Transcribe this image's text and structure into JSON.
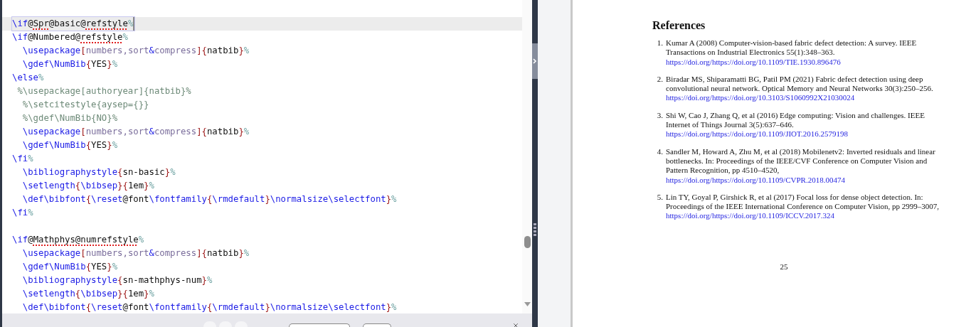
{
  "editor": {
    "lines": [
      {
        "current": true,
        "tokens": [
          {
            "kind": "cmd",
            "text": "\\if"
          },
          {
            "kind": "arg",
            "text": "@"
          },
          {
            "kind": "misspelled",
            "text": "Spr"
          },
          {
            "kind": "arg",
            "text": "@basic@"
          },
          {
            "kind": "misspelled",
            "text": "refstyle"
          },
          {
            "kind": "pct",
            "text": "%"
          }
        ]
      },
      {
        "current": false,
        "tokens": [
          {
            "kind": "cmd",
            "text": "\\if"
          },
          {
            "kind": "arg",
            "text": "@Numbered@"
          },
          {
            "kind": "misspelled",
            "text": "refstyle"
          },
          {
            "kind": "pct",
            "text": "%"
          }
        ]
      },
      {
        "current": false,
        "tokens": [
          {
            "kind": "cmd",
            "text": "  \\usepackage"
          },
          {
            "kind": "brace",
            "text": "["
          },
          {
            "kind": "opt",
            "text": "numbers,sort"
          },
          {
            "kind": "cmd",
            "text": "&"
          },
          {
            "kind": "opt",
            "text": "compress"
          },
          {
            "kind": "brace",
            "text": "]"
          },
          {
            "kind": "brace",
            "text": "{"
          },
          {
            "kind": "arg",
            "text": "natbib"
          },
          {
            "kind": "brace",
            "text": "}"
          },
          {
            "kind": "pct",
            "text": "%"
          }
        ]
      },
      {
        "current": false,
        "tokens": [
          {
            "kind": "cmd",
            "text": "  \\gdef\\NumBib"
          },
          {
            "kind": "brace",
            "text": "{"
          },
          {
            "kind": "arg",
            "text": "YES"
          },
          {
            "kind": "brace",
            "text": "}"
          },
          {
            "kind": "pct",
            "text": "%"
          }
        ]
      },
      {
        "current": false,
        "tokens": [
          {
            "kind": "cmd",
            "text": "\\else"
          },
          {
            "kind": "pct",
            "text": "%"
          }
        ]
      },
      {
        "current": false,
        "tokens": [
          {
            "kind": "comment",
            "text": " %\\usepackage[authoryear]{natbib}%"
          }
        ]
      },
      {
        "current": false,
        "tokens": [
          {
            "kind": "comment",
            "text": "  %\\setcitestyle{aysep={}}"
          }
        ]
      },
      {
        "current": false,
        "tokens": [
          {
            "kind": "comment",
            "text": "  %\\gdef\\NumBib{NO}%"
          }
        ]
      },
      {
        "current": false,
        "tokens": [
          {
            "kind": "cmd",
            "text": "  \\usepackage"
          },
          {
            "kind": "brace",
            "text": "["
          },
          {
            "kind": "opt",
            "text": "numbers,sort"
          },
          {
            "kind": "cmd",
            "text": "&"
          },
          {
            "kind": "opt",
            "text": "compress"
          },
          {
            "kind": "brace",
            "text": "]"
          },
          {
            "kind": "brace",
            "text": "{"
          },
          {
            "kind": "arg",
            "text": "natbib"
          },
          {
            "kind": "brace",
            "text": "}"
          },
          {
            "kind": "pct",
            "text": "%"
          }
        ]
      },
      {
        "current": false,
        "tokens": [
          {
            "kind": "cmd",
            "text": "  \\gdef\\NumBib"
          },
          {
            "kind": "brace",
            "text": "{"
          },
          {
            "kind": "arg",
            "text": "YES"
          },
          {
            "kind": "brace",
            "text": "}"
          },
          {
            "kind": "pct",
            "text": "%"
          }
        ]
      },
      {
        "current": false,
        "tokens": [
          {
            "kind": "cmd",
            "text": "\\fi"
          },
          {
            "kind": "pct",
            "text": "%"
          }
        ]
      },
      {
        "current": false,
        "tokens": [
          {
            "kind": "cmd",
            "text": "  \\bibliographystyle"
          },
          {
            "kind": "brace",
            "text": "{"
          },
          {
            "kind": "arg",
            "text": "sn-basic"
          },
          {
            "kind": "brace",
            "text": "}"
          },
          {
            "kind": "pct",
            "text": "%"
          }
        ]
      },
      {
        "current": false,
        "tokens": [
          {
            "kind": "cmd",
            "text": "  \\setlength"
          },
          {
            "kind": "brace",
            "text": "{"
          },
          {
            "kind": "cmd",
            "text": "\\bibsep"
          },
          {
            "kind": "brace",
            "text": "}{"
          },
          {
            "kind": "arg",
            "text": "1em"
          },
          {
            "kind": "brace",
            "text": "}"
          },
          {
            "kind": "pct",
            "text": "%"
          }
        ]
      },
      {
        "current": false,
        "tokens": [
          {
            "kind": "cmd",
            "text": "  \\def\\bibfont"
          },
          {
            "kind": "brace",
            "text": "{"
          },
          {
            "kind": "cmd",
            "text": "\\reset"
          },
          {
            "kind": "arg",
            "text": "@font"
          },
          {
            "kind": "cmd",
            "text": "\\fontfamily"
          },
          {
            "kind": "brace",
            "text": "{"
          },
          {
            "kind": "cmd",
            "text": "\\rmdefault"
          },
          {
            "kind": "brace",
            "text": "}"
          },
          {
            "kind": "cmd",
            "text": "\\normalsize\\selectfont"
          },
          {
            "kind": "brace",
            "text": "}"
          },
          {
            "kind": "pct",
            "text": "%"
          }
        ]
      },
      {
        "current": false,
        "tokens": [
          {
            "kind": "cmd",
            "text": "\\fi"
          },
          {
            "kind": "pct",
            "text": "%"
          }
        ]
      },
      {
        "current": false
      },
      {
        "current": false,
        "tokens": [
          {
            "kind": "cmd",
            "text": "\\if"
          },
          {
            "kind": "arg",
            "text": "@"
          },
          {
            "kind": "misspelled",
            "text": "Mathphys@numrefstyle"
          },
          {
            "kind": "pct",
            "text": "%"
          }
        ]
      },
      {
        "current": false,
        "tokens": [
          {
            "kind": "cmd",
            "text": "  \\usepackage"
          },
          {
            "kind": "brace",
            "text": "["
          },
          {
            "kind": "opt",
            "text": "numbers,sort"
          },
          {
            "kind": "cmd",
            "text": "&"
          },
          {
            "kind": "opt",
            "text": "compress"
          },
          {
            "kind": "brace",
            "text": "]"
          },
          {
            "kind": "brace",
            "text": "{"
          },
          {
            "kind": "arg",
            "text": "natbib"
          },
          {
            "kind": "brace",
            "text": "}"
          },
          {
            "kind": "pct",
            "text": "%"
          }
        ]
      },
      {
        "current": false,
        "tokens": [
          {
            "kind": "cmd",
            "text": "  \\gdef\\NumBib"
          },
          {
            "kind": "brace",
            "text": "{"
          },
          {
            "kind": "arg",
            "text": "YES"
          },
          {
            "kind": "brace",
            "text": "}"
          },
          {
            "kind": "pct",
            "text": "%"
          }
        ]
      },
      {
        "current": false,
        "tokens": [
          {
            "kind": "cmd",
            "text": "  \\bibliographystyle"
          },
          {
            "kind": "brace",
            "text": "{"
          },
          {
            "kind": "arg",
            "text": "sn-mathphys-num"
          },
          {
            "kind": "brace",
            "text": "}"
          },
          {
            "kind": "pct",
            "text": "%"
          }
        ]
      },
      {
        "current": false,
        "tokens": [
          {
            "kind": "cmd",
            "text": "  \\setlength"
          },
          {
            "kind": "brace",
            "text": "{"
          },
          {
            "kind": "cmd",
            "text": "\\bibsep"
          },
          {
            "kind": "brace",
            "text": "}{"
          },
          {
            "kind": "arg",
            "text": "1em"
          },
          {
            "kind": "brace",
            "text": "}"
          },
          {
            "kind": "pct",
            "text": "%"
          }
        ]
      },
      {
        "current": false,
        "tokens": [
          {
            "kind": "cmd",
            "text": "  \\def\\bibfont"
          },
          {
            "kind": "brace",
            "text": "{"
          },
          {
            "kind": "cmd",
            "text": "\\reset"
          },
          {
            "kind": "arg",
            "text": "@font"
          },
          {
            "kind": "cmd",
            "text": "\\fontfamily"
          },
          {
            "kind": "brace",
            "text": "{"
          },
          {
            "kind": "cmd",
            "text": "\\rmdefault"
          },
          {
            "kind": "brace",
            "text": "}"
          },
          {
            "kind": "cmd",
            "text": "\\normalsize\\selectfont"
          },
          {
            "kind": "brace",
            "text": "}"
          },
          {
            "kind": "pct",
            "text": "%"
          }
        ]
      }
    ]
  },
  "pdf": {
    "heading": "References",
    "references": [
      {
        "number": "1.",
        "text": "Kumar A (2008) Computer-vision-based fabric defect detection: A survey. IEEE Transactions on Industrial Electronics 55(1):348–363.",
        "link": "https://doi.org/https://doi.org/10.1109/TIE.1930.896476"
      },
      {
        "number": "2.",
        "text": "Biradar MS, Shiparamatti BG, Patil PM (2021) Fabric defect detection using deep convolutional neural network. Optical Memory and Neural Networks 30(3):250–256.",
        "link": "https://doi.org/https://doi.org/10.3103/S1060992X21030024"
      },
      {
        "number": "3.",
        "text": "Shi W, Cao J, Zhang Q, et al (2016) Edge computing: Vision and challenges. IEEE Internet of Things Journal 3(5):637–646.",
        "link": "https://doi.org/https://doi.org/10.1109/JIOT.2016.2579198"
      },
      {
        "number": "4.",
        "text": "Sandler M, Howard A, Zhu M, et al (2018) Mobilenetv2: Inverted residuals and linear bottlenecks. In: Proceedings of the IEEE/CVF Conference on Computer Vision and Pattern Recognition, pp 4510–4520,",
        "link": "https://doi.org/https://doi.org/10.1109/CVPR.2018.00474"
      },
      {
        "number": "5.",
        "text": "Lin TY, Goyal P, Girshick R, et al (2017) Focal loss for dense object detection. In: Proceedings of the IEEE International Conference on Computer Vision, pp 2999–3007,",
        "link": "https://doi.org/https://doi.org/10.1109/ICCV.2017.324"
      }
    ],
    "page_number": "25"
  }
}
